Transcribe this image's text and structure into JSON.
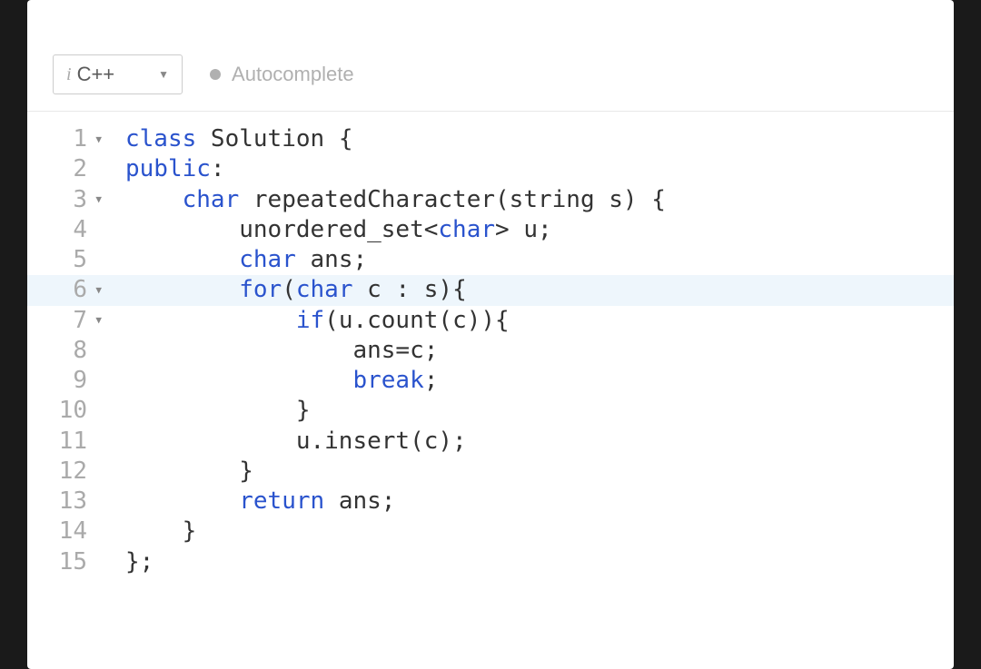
{
  "toolbar": {
    "language": "C++",
    "autocomplete_label": "Autocomplete"
  },
  "code": {
    "lines": [
      {
        "num": "1",
        "foldable": true,
        "highlighted": false,
        "indent": "",
        "tokens": [
          {
            "t": "class ",
            "c": "kw"
          },
          {
            "t": "Solution ",
            "c": "cls"
          },
          {
            "t": "{",
            "c": "punc"
          }
        ]
      },
      {
        "num": "2",
        "foldable": false,
        "highlighted": false,
        "indent": "",
        "tokens": [
          {
            "t": "public",
            "c": "lbl"
          },
          {
            "t": ":",
            "c": "punc"
          }
        ]
      },
      {
        "num": "3",
        "foldable": true,
        "highlighted": false,
        "indent": "    ",
        "tokens": [
          {
            "t": "char ",
            "c": "kw"
          },
          {
            "t": "repeatedCharacter",
            "c": "fn"
          },
          {
            "t": "(",
            "c": "punc"
          },
          {
            "t": "string ",
            "c": "type"
          },
          {
            "t": "s",
            "c": ""
          },
          {
            "t": ") {",
            "c": "punc"
          }
        ]
      },
      {
        "num": "4",
        "foldable": false,
        "highlighted": false,
        "indent": "        ",
        "tokens": [
          {
            "t": "unordered_set",
            "c": "type"
          },
          {
            "t": "<",
            "c": "punc"
          },
          {
            "t": "char",
            "c": "kw"
          },
          {
            "t": "> ",
            "c": "punc"
          },
          {
            "t": "u",
            "c": ""
          },
          {
            "t": ";",
            "c": "punc"
          }
        ]
      },
      {
        "num": "5",
        "foldable": false,
        "highlighted": false,
        "indent": "        ",
        "tokens": [
          {
            "t": "char ",
            "c": "kw"
          },
          {
            "t": "ans",
            "c": ""
          },
          {
            "t": ";",
            "c": "punc"
          }
        ]
      },
      {
        "num": "6",
        "foldable": true,
        "highlighted": true,
        "indent": "        ",
        "tokens": [
          {
            "t": "for",
            "c": "kw"
          },
          {
            "t": "(",
            "c": "punc"
          },
          {
            "t": "char ",
            "c": "kw"
          },
          {
            "t": "c ",
            "c": ""
          },
          {
            "t": ": ",
            "c": "punc"
          },
          {
            "t": "s",
            "c": ""
          },
          {
            "t": "){",
            "c": "punc"
          }
        ]
      },
      {
        "num": "7",
        "foldable": true,
        "highlighted": false,
        "indent": "            ",
        "tokens": [
          {
            "t": "if",
            "c": "kw"
          },
          {
            "t": "(",
            "c": "punc"
          },
          {
            "t": "u",
            "c": ""
          },
          {
            "t": ".",
            "c": "punc"
          },
          {
            "t": "count",
            "c": "fn"
          },
          {
            "t": "(",
            "c": "punc"
          },
          {
            "t": "c",
            "c": ""
          },
          {
            "t": ")){",
            "c": "punc"
          }
        ]
      },
      {
        "num": "8",
        "foldable": false,
        "highlighted": false,
        "indent": "                ",
        "tokens": [
          {
            "t": "ans",
            "c": ""
          },
          {
            "t": "=",
            "c": "punc"
          },
          {
            "t": "c",
            "c": ""
          },
          {
            "t": ";",
            "c": "punc"
          }
        ]
      },
      {
        "num": "9",
        "foldable": false,
        "highlighted": false,
        "indent": "                ",
        "tokens": [
          {
            "t": "break",
            "c": "kw"
          },
          {
            "t": ";",
            "c": "punc"
          }
        ]
      },
      {
        "num": "10",
        "foldable": false,
        "highlighted": false,
        "indent": "            ",
        "tokens": [
          {
            "t": "}",
            "c": "punc"
          }
        ]
      },
      {
        "num": "11",
        "foldable": false,
        "highlighted": false,
        "indent": "            ",
        "tokens": [
          {
            "t": "u",
            "c": ""
          },
          {
            "t": ".",
            "c": "punc"
          },
          {
            "t": "insert",
            "c": "fn"
          },
          {
            "t": "(",
            "c": "punc"
          },
          {
            "t": "c",
            "c": ""
          },
          {
            "t": ");",
            "c": "punc"
          }
        ]
      },
      {
        "num": "12",
        "foldable": false,
        "highlighted": false,
        "indent": "        ",
        "tokens": [
          {
            "t": "}",
            "c": "punc"
          }
        ]
      },
      {
        "num": "13",
        "foldable": false,
        "highlighted": false,
        "indent": "        ",
        "tokens": [
          {
            "t": "return ",
            "c": "kw"
          },
          {
            "t": "ans",
            "c": ""
          },
          {
            "t": ";",
            "c": "punc"
          }
        ]
      },
      {
        "num": "14",
        "foldable": false,
        "highlighted": false,
        "indent": "    ",
        "tokens": [
          {
            "t": "}",
            "c": "punc"
          }
        ]
      },
      {
        "num": "15",
        "foldable": false,
        "highlighted": false,
        "indent": "",
        "tokens": [
          {
            "t": "};",
            "c": "punc"
          }
        ]
      }
    ]
  }
}
